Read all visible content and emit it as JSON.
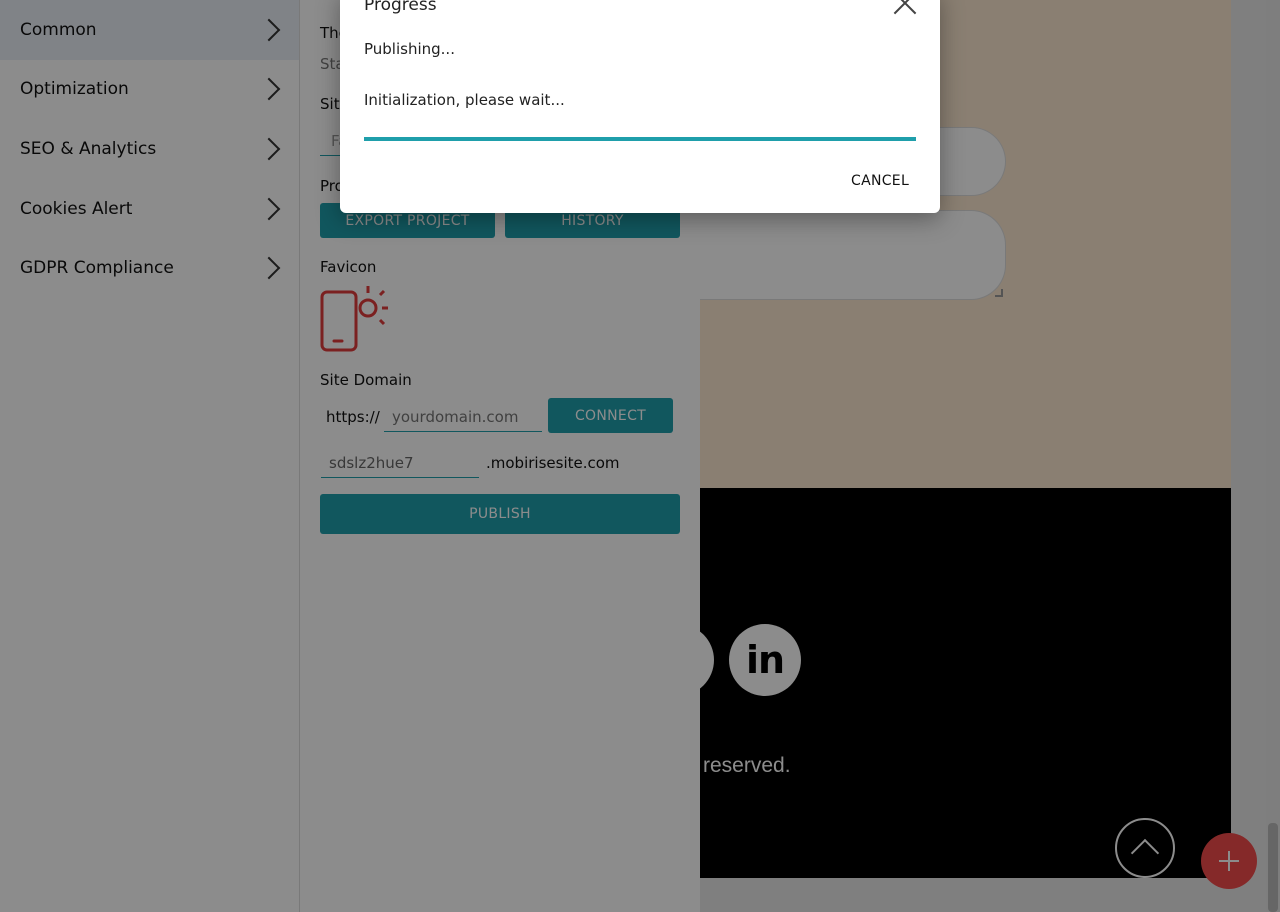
{
  "nav": {
    "items": [
      {
        "label": "Common"
      },
      {
        "label": "Optimization"
      },
      {
        "label": "SEO & Analytics"
      },
      {
        "label": "Cookies Alert"
      },
      {
        "label": "GDPR Compliance"
      }
    ]
  },
  "settings": {
    "partial_label_1": "The",
    "partial_label_2": "Sta",
    "partial_label_3": "Site",
    "partial_input": "Fa",
    "partial_label_4": "Pro",
    "export_button": "EXPORT PROJECT",
    "history_button": "HISTORY",
    "favicon_label": "Favicon",
    "site_domain_label": "Site Domain",
    "https_prefix": "https://",
    "domain_placeholder": "yourdomain.com",
    "connect_button": "CONNECT",
    "subdomain_value": "sdslz2hue7",
    "subdomain_suffix": ".mobirisesite.com",
    "publish_button": "PUBLISH"
  },
  "preview": {
    "copyright_partial": "reserved.",
    "social_icon_label": "in"
  },
  "dialog": {
    "title": "Progress",
    "status": "Publishing...",
    "detail": "Initialization, please wait...",
    "progress_percent": 100,
    "cancel_button": "CANCEL"
  },
  "colors": {
    "accent": "#1f9fab",
    "fab": "#f24b4b",
    "favicon": "#e03c3c"
  },
  "icons": {
    "favicon": "mobile-phone-sun-icon",
    "fab": "plus-icon",
    "scroll_top": "chevron-up-icon",
    "social": "linkedin-icon"
  }
}
